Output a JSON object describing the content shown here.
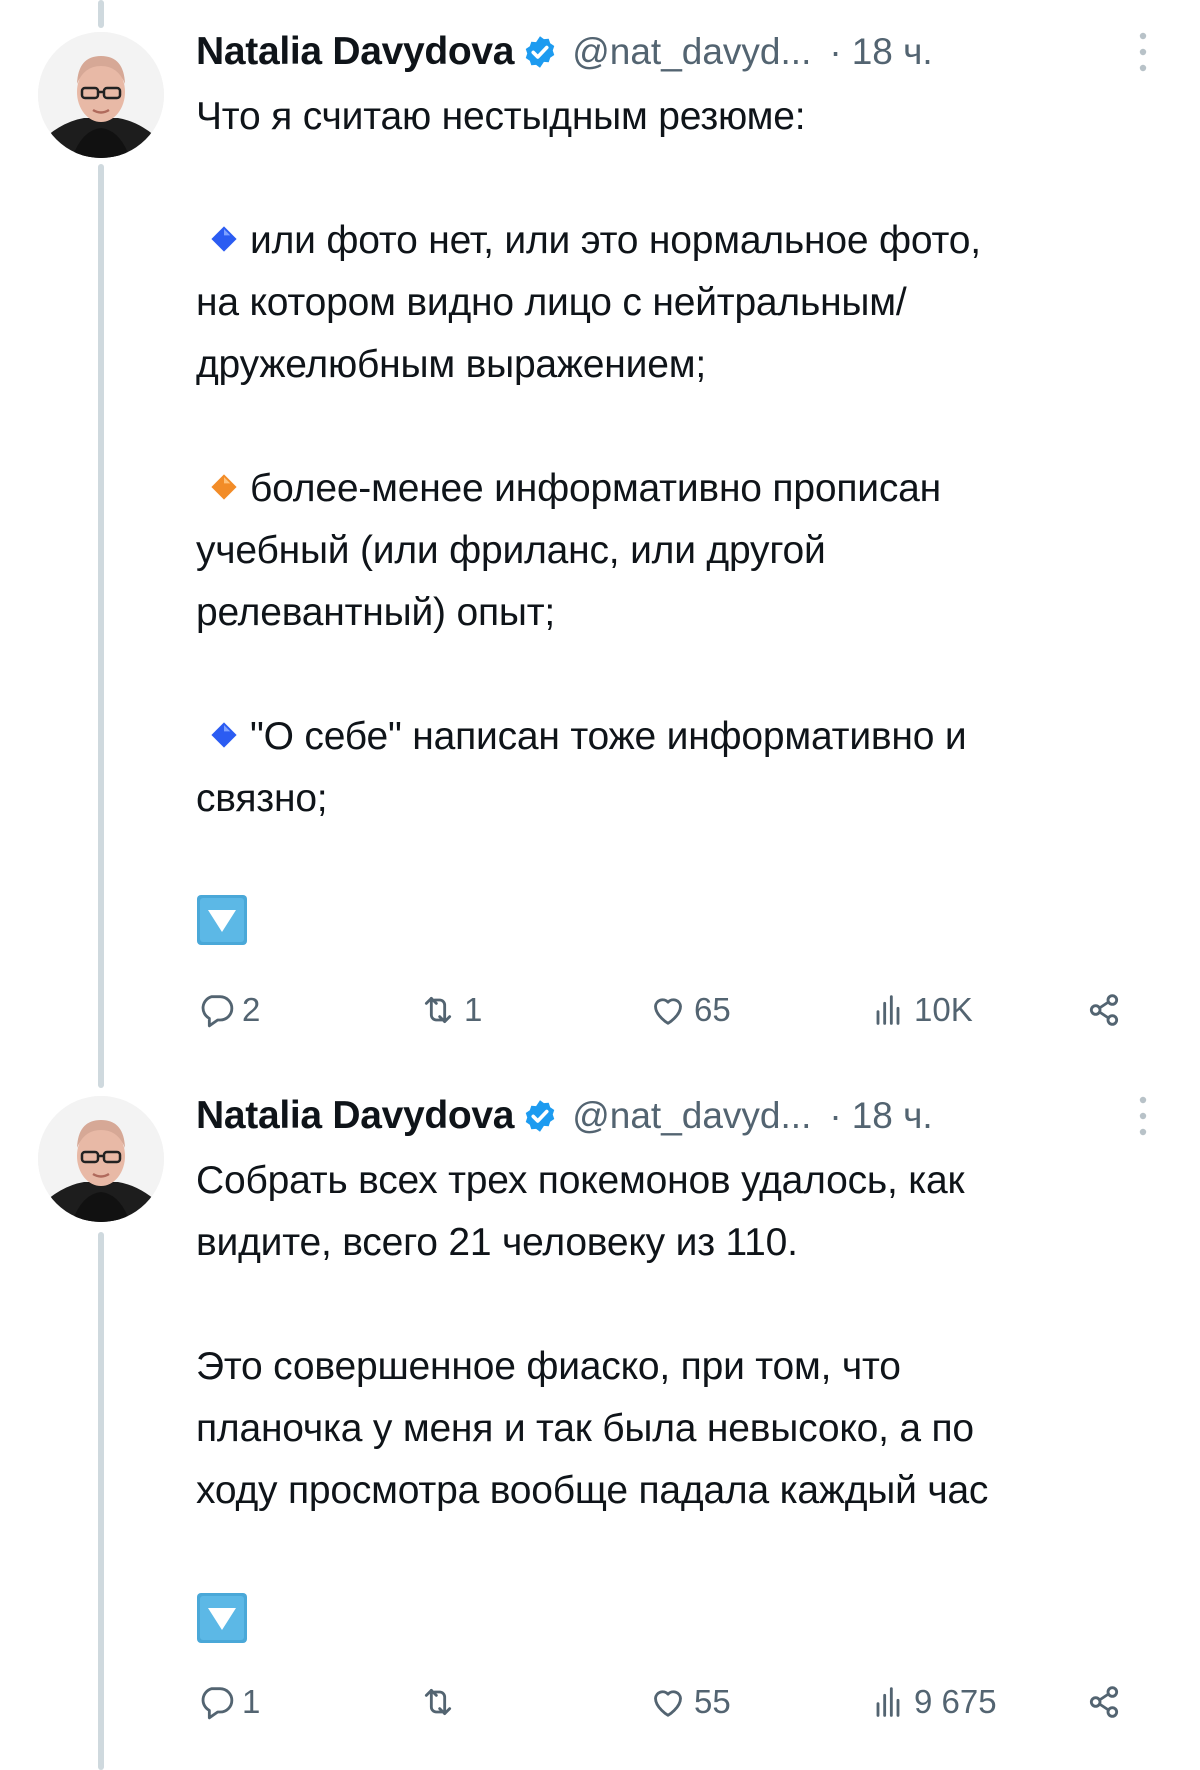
{
  "colors": {
    "text": "#0f1419",
    "muted": "#536471",
    "verified": "#1d9bf0",
    "thread_line": "#cfd9de",
    "blue_diamond": "#2b5cf2",
    "orange_diamond": "#f28c28",
    "emoji_bg": "#4aa8d8"
  },
  "tweets": [
    {
      "author": {
        "name": "Natalia Davydova",
        "handle": "@nat_davyd...",
        "verified": true,
        "avatar": "avatar-photo"
      },
      "separator": "·",
      "time": "18 ч.",
      "lines": [
        {
          "kind": "text",
          "text": "Что я считаю нестыдным резюме:"
        },
        {
          "kind": "gap"
        },
        {
          "kind": "bullet",
          "icon": "small-blue-diamond-icon",
          "text": "или фото нет, или это нормальное фото,"
        },
        {
          "kind": "text",
          "text": "на котором видно лицо с нейтральным/"
        },
        {
          "kind": "text",
          "text": "дружелюбным выражением;"
        },
        {
          "kind": "gap"
        },
        {
          "kind": "bullet",
          "icon": "small-orange-diamond-icon",
          "text": "более-менее информативно прописан"
        },
        {
          "kind": "text",
          "text": "учебный (или фриланс, или другой"
        },
        {
          "kind": "text",
          "text": "релевантный) опыт;"
        },
        {
          "kind": "gap"
        },
        {
          "kind": "bullet",
          "icon": "small-blue-diamond-icon",
          "text": "\"О себе\" написан тоже информативно и"
        },
        {
          "kind": "text",
          "text": "связно;"
        }
      ],
      "emoji": "down-button-icon",
      "stats": {
        "replies": "2",
        "reposts": "1",
        "likes": "65",
        "views": "10K"
      }
    },
    {
      "author": {
        "name": "Natalia Davydova",
        "handle": "@nat_davyd...",
        "verified": true,
        "avatar": "avatar-photo"
      },
      "separator": "·",
      "time": "18 ч.",
      "lines": [
        {
          "kind": "text",
          "text": "Собрать всех трех покемонов удалось, как"
        },
        {
          "kind": "text",
          "text": "видите, всего 21 человеку из 110."
        },
        {
          "kind": "gap"
        },
        {
          "kind": "text",
          "text": "Это совершенное фиаско, при том, что"
        },
        {
          "kind": "text",
          "text": "планочка у меня и так была невысоко, а по"
        },
        {
          "kind": "text",
          "text": "ходу просмотра вообще падала каждый час"
        }
      ],
      "emoji": "down-button-icon",
      "stats": {
        "replies": "1",
        "reposts": "",
        "likes": "55",
        "views": "9 675"
      }
    }
  ]
}
